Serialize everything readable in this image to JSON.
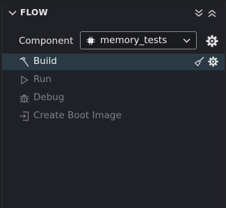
{
  "panel": {
    "title": "FLOW",
    "header_icons": [
      "chevron-down-icon",
      "collapse-all-icon",
      "expand-all-icon"
    ]
  },
  "component": {
    "label": "Component",
    "selected": "memory_tests",
    "chip_icon": "chip-icon",
    "dropdown_icon": "chevron-down-icon",
    "settings_icon": "gear-icon"
  },
  "tasks": [
    {
      "label": "Build",
      "icon": "hammer-icon",
      "active": true,
      "actions": [
        "broom-icon",
        "gear-icon"
      ]
    },
    {
      "label": "Run",
      "icon": "play-icon",
      "active": false
    },
    {
      "label": "Debug",
      "icon": "bug-icon",
      "active": false
    },
    {
      "label": "Create Boot Image",
      "icon": "boot-image-icon",
      "active": false
    }
  ],
  "colors": {
    "background": "#202126",
    "active_row": "#293a45",
    "text": "#e6e6e6",
    "disabled_text": "#7f8186"
  }
}
